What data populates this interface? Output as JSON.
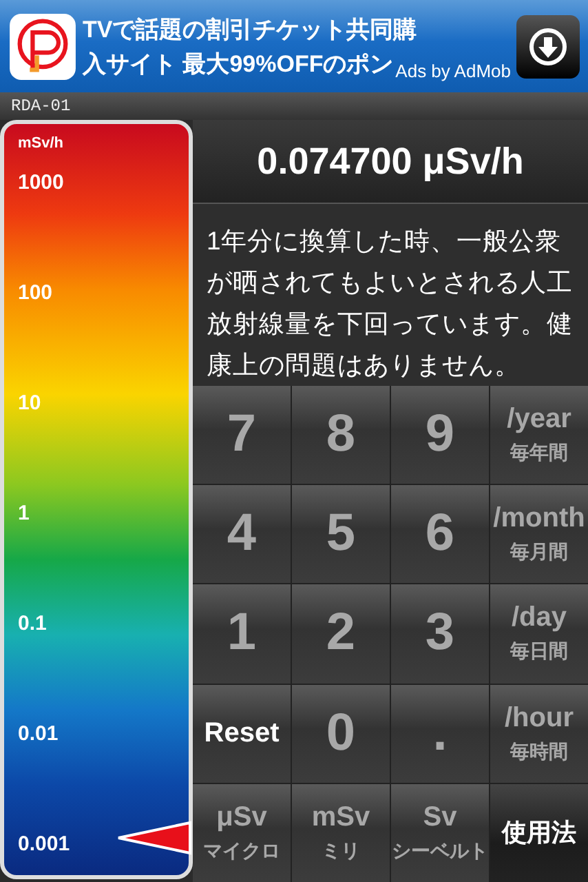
{
  "ad": {
    "line1": "TVで話題の割引チケット共同購",
    "line2": "入サイト 最大99%OFFのポン",
    "attribution": "Ads by AdMob"
  },
  "device": "RDA-01",
  "scale": {
    "unit": "mSv/h",
    "labels": [
      "1000",
      "100",
      "10",
      "1",
      "0.1",
      "0.01",
      "0.001"
    ]
  },
  "reading": "0.074700 μSv/h",
  "message": "1年分に換算した時、一般公衆が晒されてもよいとされる人工放射線量を下回っています。健康上の問題はありません。",
  "keys": [
    {
      "kind": "digit",
      "label": "7"
    },
    {
      "kind": "digit",
      "label": "8"
    },
    {
      "kind": "digit",
      "label": "9"
    },
    {
      "kind": "unit",
      "label": "/year",
      "sub": "毎年間"
    },
    {
      "kind": "digit",
      "label": "4"
    },
    {
      "kind": "digit",
      "label": "5"
    },
    {
      "kind": "digit",
      "label": "6"
    },
    {
      "kind": "unit",
      "label": "/month",
      "sub": "毎月間"
    },
    {
      "kind": "digit",
      "label": "1"
    },
    {
      "kind": "digit",
      "label": "2"
    },
    {
      "kind": "digit",
      "label": "3"
    },
    {
      "kind": "unit",
      "label": "/day",
      "sub": "毎日間"
    },
    {
      "kind": "action",
      "label": "Reset"
    },
    {
      "kind": "digit",
      "label": "0"
    },
    {
      "kind": "digit",
      "label": "."
    },
    {
      "kind": "unit",
      "label": "/hour",
      "sub": "毎時間"
    },
    {
      "kind": "unit",
      "label": "μSv",
      "sub": "マイクロ"
    },
    {
      "kind": "unit",
      "label": "mSv",
      "sub": "ミリ"
    },
    {
      "kind": "unit",
      "label": "Sv",
      "sub": "シーベルト"
    },
    {
      "kind": "help",
      "label": "使用法"
    }
  ]
}
